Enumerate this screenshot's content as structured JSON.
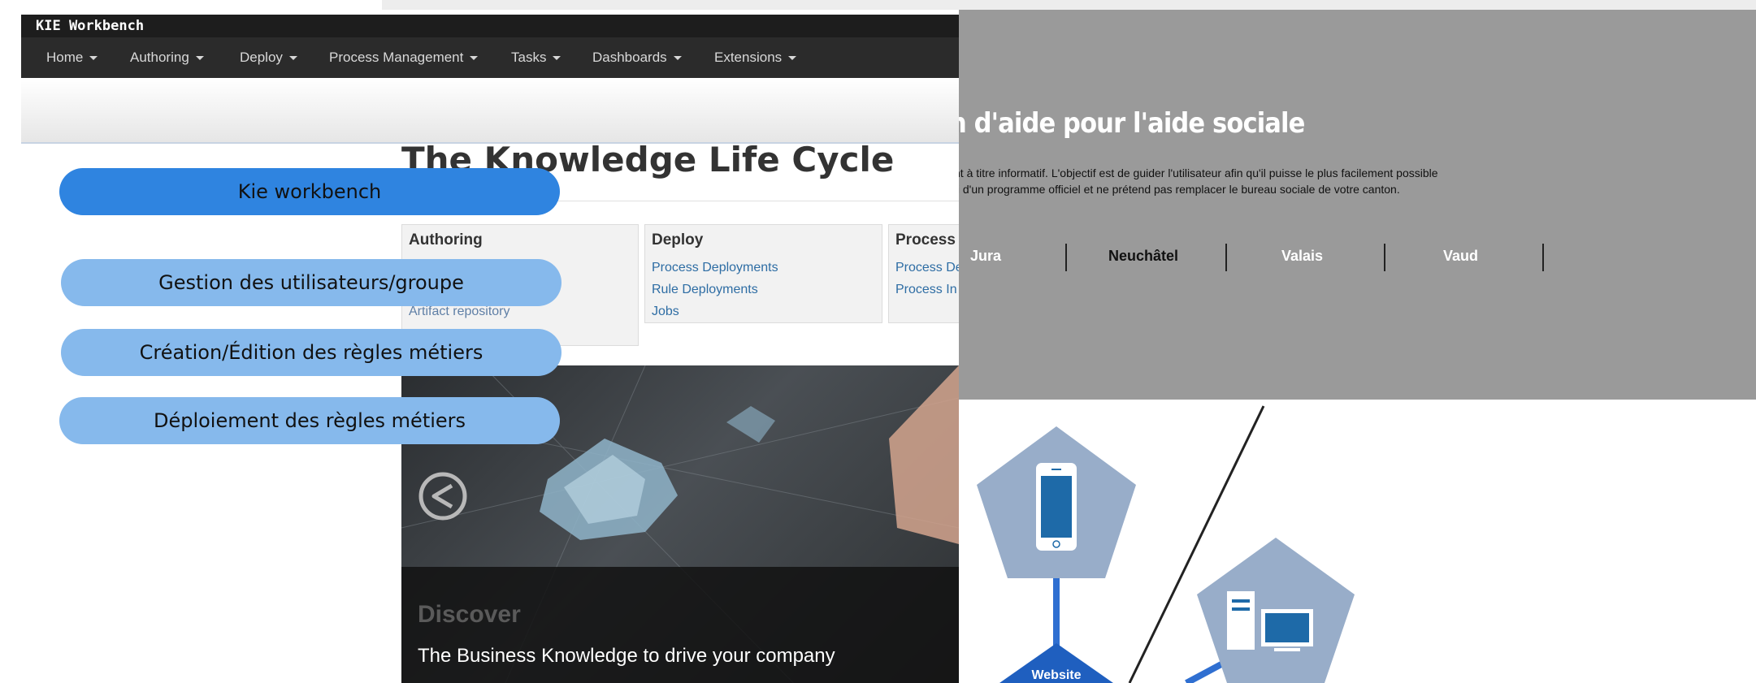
{
  "kie": {
    "brand": "KIE Workbench",
    "nav": [
      {
        "label": "Home"
      },
      {
        "label": "Authoring"
      },
      {
        "label": "Deploy"
      },
      {
        "label": "Process Management"
      },
      {
        "label": "Tasks"
      },
      {
        "label": "Dashboards"
      },
      {
        "label": "Extensions"
      }
    ],
    "heading": "The Knowledge Life Cycle",
    "cards": [
      {
        "title": "Authoring",
        "links": [
          "Artifact repository"
        ]
      },
      {
        "title": "Deploy",
        "links": [
          "Process Deployments",
          "Rule Deployments",
          "Jobs"
        ]
      },
      {
        "title": "Process",
        "links": [
          "Process De",
          "Process In"
        ]
      }
    ],
    "hero": {
      "label": "Discover",
      "tagline": "The Business Knowledge to drive your company"
    }
  },
  "pills": {
    "kie": "Kie workbench",
    "users": "Gestion des utilisateurs/groupe",
    "rules_edit": "Création/Édition des règles métiers",
    "rules_deploy": "Déploiement des règles métiers"
  },
  "site": {
    "title": "n d'aide pour l'aide sociale",
    "line1": "nt à titre informatif. L'objectif est de guider l'utilisateur afin qu'il puisse le plus facilement possible",
    "line2": "ti d'un programme officiel et ne prétend pas remplacer le bureau sociale de votre canton.",
    "cantons": [
      "Jura",
      "Neuchâtel",
      "Valais",
      "Vaud"
    ],
    "active_canton": "Neuchâtel"
  },
  "diagram": {
    "website_label": "Website",
    "icons": [
      "mobile-phone-icon",
      "desktop-computer-icon"
    ],
    "colors": {
      "node": "#98adc9",
      "accent": "#2f6fd1",
      "website": "#1f5fbf"
    }
  },
  "colors": {
    "pill_dark": "#2f84e0",
    "pill_light": "#86b9ec",
    "nav_bg": "#2b2b2b",
    "link": "#2e6da4"
  }
}
